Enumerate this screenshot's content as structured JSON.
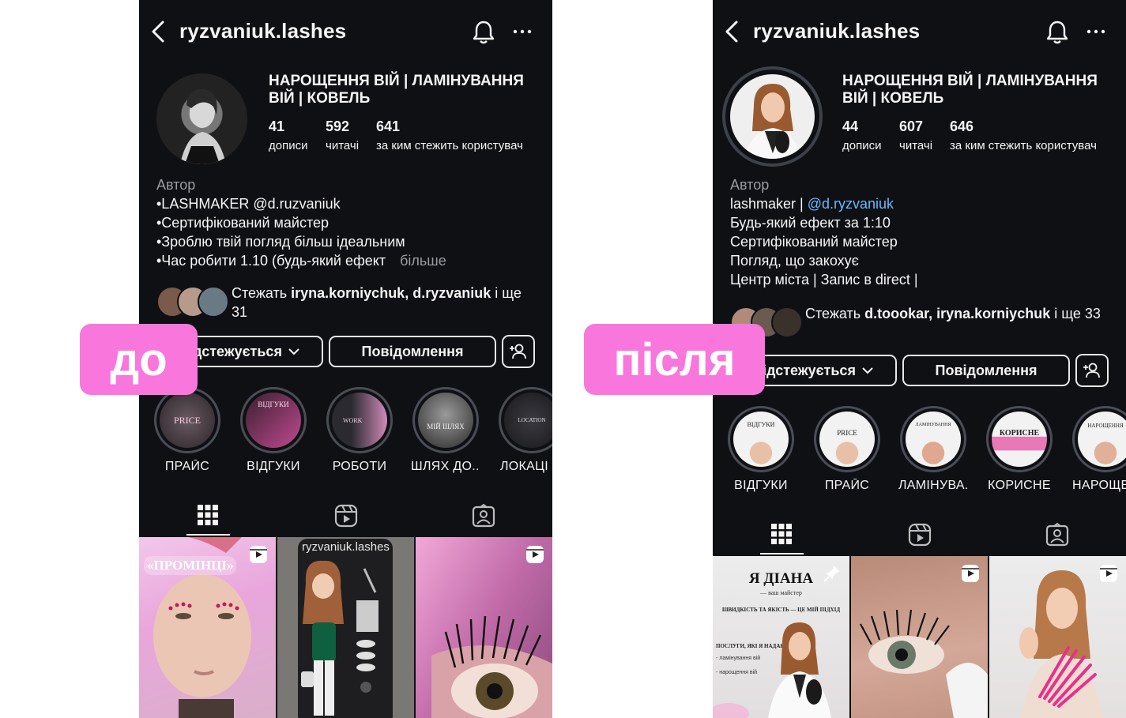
{
  "before": {
    "username": "ryzvaniuk.lashes",
    "name": "НАРОЩЕННЯ ВІЙ | ЛАМІНУВАННЯ ВІЙ | КОВЕЛЬ",
    "stats": [
      {
        "value": "41",
        "label": "дописи"
      },
      {
        "value": "592",
        "label": "читачі"
      },
      {
        "value": "641",
        "label": "за ким стежить користувач"
      }
    ],
    "bio": {
      "category": "Автор",
      "lines": [
        "•LASHMAKER @d.ruzvaniuk",
        "•Сертифікований майстер",
        "•Зроблю твій погляд більш ідеальним",
        "•Час робити 1.10 (будь-який ефект"
      ],
      "more": "більше"
    },
    "followed_by": {
      "prefix": "Стежать ",
      "names": "iryna.korniychuk, d.ryzvaniuk",
      "suffix": " і ще 31"
    },
    "buttons": {
      "following": "Відстежується",
      "message": "Повідомлення"
    },
    "highlights": [
      "ПРАЙС",
      "ВІДГУКИ",
      "РОБОТИ",
      "ШЛЯХ ДО...",
      "ЛОКАЦІ"
    ],
    "highlight_covers": [
      "PRICE",
      "ВІДГУКИ",
      "WORK",
      "МІЙ ШЛЯХ",
      "LOCATION"
    ],
    "posts": [
      {
        "caption": "«ПРОМІНЦІ»",
        "type": "reel"
      },
      {
        "caption": "ryzvaniuk.lashes",
        "type": "image"
      },
      {
        "caption": "",
        "type": "reel"
      }
    ]
  },
  "after": {
    "username": "ryzvaniuk.lashes",
    "name": "НАРОЩЕННЯ ВІЙ | ЛАМІНУВАННЯ ВІЙ | КОВЕЛЬ",
    "stats": [
      {
        "value": "44",
        "label": "дописи"
      },
      {
        "value": "607",
        "label": "читачі"
      },
      {
        "value": "646",
        "label": "за ким стежить користувач"
      }
    ],
    "bio": {
      "category": "Автор",
      "line1_prefix": "lashmaker | ",
      "line1_mention": "@d.ryzvaniuk",
      "lines": [
        "Будь-який ефект за 1:10",
        "Сертифікований майстер",
        "Погляд, що закохує",
        "Центр міста | Запис в direct |"
      ]
    },
    "followed_by": {
      "prefix": "Стежать ",
      "names": "d.toookar, iryna.korniychuk",
      "suffix": " і ще 33"
    },
    "buttons": {
      "following": "Відстежується",
      "message": "Повідомлення"
    },
    "highlights": [
      "ВІДГУКИ",
      "ПРАЙС",
      "ЛАМІНУВА...",
      "КОРИСНЕ",
      "НАРОЩЕН"
    ],
    "highlight_covers": [
      "ВІДГУКИ",
      "PRICE",
      "ЛАМІНУВАННЯ",
      "КОРИСНЕ",
      "НАРОЩЕННЯ"
    ],
    "posts": [
      {
        "title": "Я ДІАНА",
        "subtitle": "— ваш майстер",
        "line": "ШВИДКІСТЬ ТА ЯКІСТЬ — ЦЕ МІЙ ПІДХІД",
        "services_title": "ПОСЛУГИ, ЯКІ Я НАДАЮ:",
        "services": [
          "- ламінування вій",
          "- нарощення вій"
        ],
        "type": "pinned"
      },
      {
        "type": "reel"
      },
      {
        "type": "reel"
      }
    ]
  },
  "tags": {
    "before": "до",
    "after": "після"
  },
  "colors": {
    "background": "#0f1014",
    "accent_tag": "#f976dc",
    "mention": "#6ab7ff"
  }
}
